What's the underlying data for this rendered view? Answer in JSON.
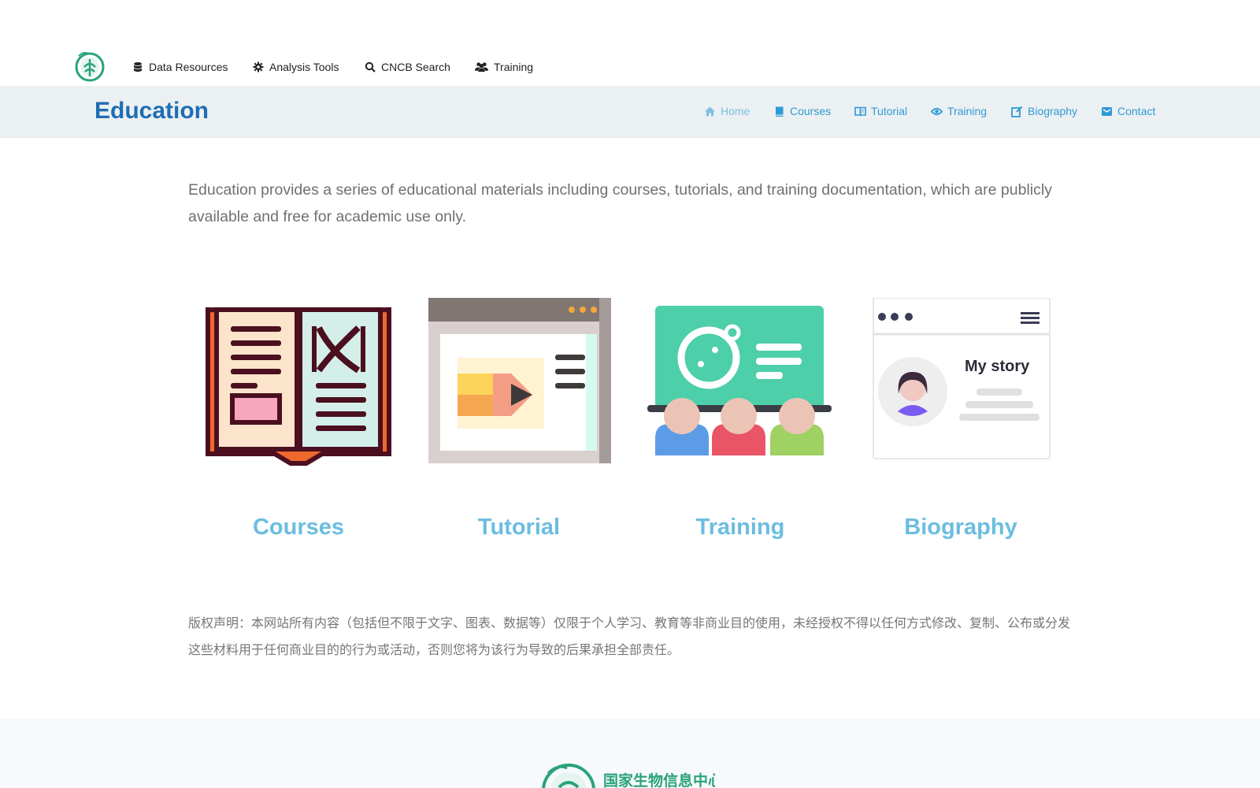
{
  "topnav": {
    "items": [
      {
        "label": "Data Resources",
        "icon": "database-icon"
      },
      {
        "label": "Analysis Tools",
        "icon": "gear-icon"
      },
      {
        "label": "CNCB Search",
        "icon": "search-icon"
      },
      {
        "label": "Training",
        "icon": "users-icon"
      }
    ]
  },
  "subheader": {
    "title": "Education",
    "nav": [
      {
        "label": "Home",
        "icon": "home-icon"
      },
      {
        "label": "Courses",
        "icon": "book-icon"
      },
      {
        "label": "Tutorial",
        "icon": "open-book-icon"
      },
      {
        "label": "Training",
        "icon": "eye-icon"
      },
      {
        "label": "Biography",
        "icon": "edit-icon"
      },
      {
        "label": "Contact",
        "icon": "mail-icon"
      }
    ]
  },
  "intro": "Education provides a series of educational materials including courses, tutorials, and training documentation, which are publicly available and free for academic use only.",
  "cards": [
    {
      "label": "Courses",
      "icon": "open-book-illustration"
    },
    {
      "label": "Tutorial",
      "icon": "browser-pencil-illustration"
    },
    {
      "label": "Training",
      "icon": "classroom-illustration"
    },
    {
      "label": "Biography",
      "icon": "profile-page-illustration",
      "illustration_text": "My story"
    }
  ],
  "notice": "版权声明：本网站所有内容（包括但不限于文字、图表、数据等）仅限于个人学习、教育等非商业目的使用，未经授权不得以任何方式修改、复制、公布或分发这些材料用于任何商业目的的行为或活动，否则您将为该行为导致的后果承担全部责任。",
  "footer": {
    "logo_text": "国家生物信息中心"
  },
  "colors": {
    "brand": "#1f6db3",
    "accent": "#2e9ad6",
    "card_label": "#6bbde0",
    "subbar_bg": "#ebf0f2"
  }
}
